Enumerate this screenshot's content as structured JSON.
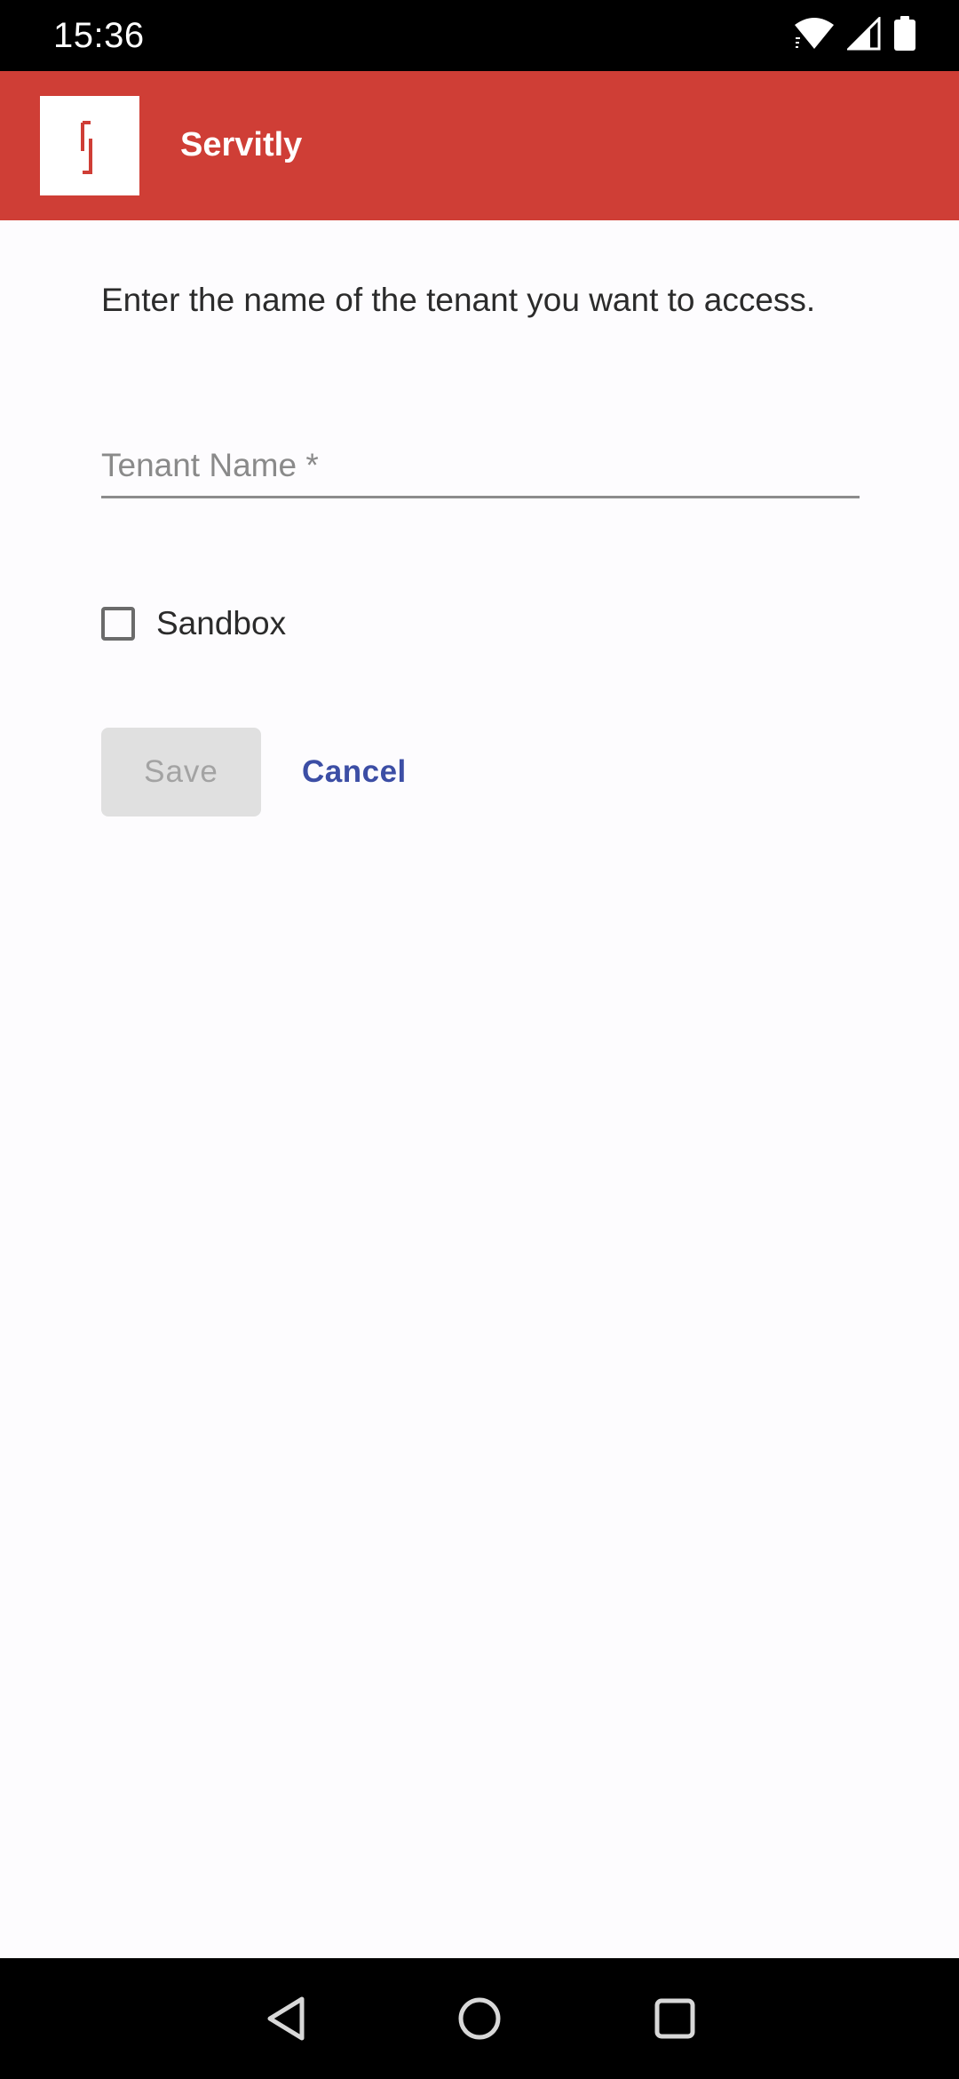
{
  "status_bar": {
    "time": "15:36",
    "icons": [
      "wifi-icon",
      "cellular-signal-icon",
      "battery-icon"
    ]
  },
  "app_bar": {
    "title": "Servitly",
    "logo": "servitly-logo",
    "color": "#cf3e36"
  },
  "form": {
    "instruction": "Enter the name of the tenant you want to access.",
    "tenant_name": {
      "placeholder": "Tenant Name *",
      "value": ""
    },
    "sandbox": {
      "label": "Sandbox",
      "checked": false
    },
    "save_label": "Save",
    "cancel_label": "Cancel"
  },
  "nav_bar": {
    "icons": [
      "back-triangle-icon",
      "home-circle-icon",
      "recents-square-icon"
    ]
  },
  "colors": {
    "accent": "#3c4ea5",
    "disabled_button": "#e0e0e0",
    "brand_red": "#cf3e36"
  }
}
